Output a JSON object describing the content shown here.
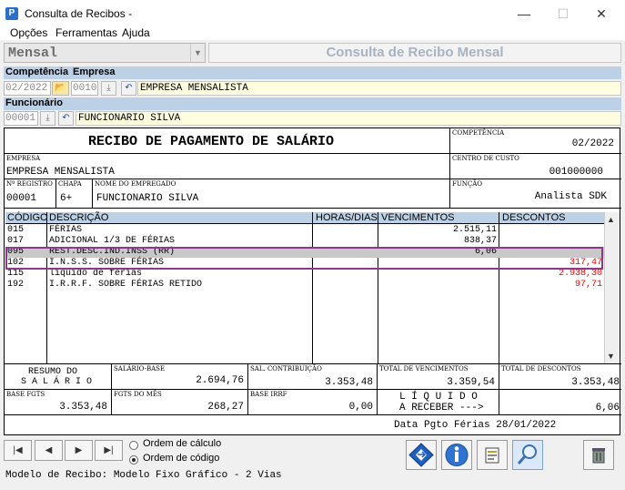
{
  "window": {
    "title": "Consulta de Recibos -",
    "app_icon": "P"
  },
  "menu": [
    "Opções",
    "Ferramentas",
    "Ajuda"
  ],
  "toolbar": {
    "mode": "Mensal",
    "banner": "Consulta de Recibo Mensal"
  },
  "filters": {
    "competencia_label": "Competência",
    "empresa_label": "Empresa",
    "competencia": "02/2022",
    "empresa_code": "0010",
    "empresa_name": "EMPRESA MENSALISTA",
    "funcionario_label": "Funcionário",
    "funcionario_code": "00001",
    "funcionario_name": "FUNCIONARIO SILVA"
  },
  "receipt": {
    "title": "RECIBO DE PAGAMENTO DE SALÁRIO",
    "competencia_cap": "COMPETÊNCIA",
    "competencia": "02/2022",
    "empresa_cap": "EMPRESA",
    "empresa": "EMPRESA MENSALISTA",
    "centro_cap": "CENTRO DE CUSTO",
    "centro": "001000000",
    "registro_cap": "Nº REGISTRO",
    "registro": "00001",
    "chapa_cap": "CHAPA",
    "chapa": "6+",
    "nome_cap": "NOME DO EMPREGADO",
    "nome": "FUNCIONARIO SILVA",
    "funcao_cap": "FUNÇÃO",
    "funcao": "Analista SDK"
  },
  "grid": {
    "headers": [
      "CÓDIGO",
      "DESCRIÇÃO",
      "HORAS/DIAS",
      "VENCIMENTOS",
      "DESCONTOS"
    ],
    "rows": [
      {
        "codigo": "015",
        "descricao": "FÉRIAS",
        "horas": "",
        "vencimentos": "2.515,11",
        "descontos": ""
      },
      {
        "codigo": "017",
        "descricao": "ADICIONAL 1/3 DE FÉRIAS",
        "horas": "",
        "vencimentos": "838,37",
        "descontos": ""
      },
      {
        "codigo": "095",
        "descricao": "REST.DESC.IND.INSS (RR)",
        "horas": "",
        "vencimentos": "6,06",
        "descontos": ""
      },
      {
        "codigo": "102",
        "descricao": "I.N.S.S. SOBRE FÉRIAS",
        "horas": "",
        "vencimentos": "",
        "descontos": "317,47"
      },
      {
        "codigo": "115",
        "descricao": "liquido de férias",
        "horas": "",
        "vencimentos": "",
        "descontos": "2.938,30"
      },
      {
        "codigo": "192",
        "descricao": "I.R.R.F. SOBRE FÉRIAS RETIDO",
        "horas": "",
        "vencimentos": "",
        "descontos": "97,71"
      }
    ],
    "discount_color": "#ff0000",
    "selected_row_color": "#c8c8c8",
    "highlight_border": "#8b3a8b"
  },
  "summary": {
    "resumo_line1": "RESUMO DO",
    "resumo_line2": "S A L Á R I O",
    "salario_base_cap": "SALÁRIO-BASE",
    "salario_base": "2.694,76",
    "sal_contrib_cap": "SAL. CONTRIBUIÇÃO",
    "sal_contrib": "3.353,48",
    "total_venc_cap": "TOTAL DE VENCIMENTOS",
    "total_venc": "3.359,54",
    "total_desc_cap": "TOTAL DE DESCONTOS",
    "total_desc": "3.353,48",
    "base_fgts_cap": "BASE FGTS",
    "base_fgts": "3.353,48",
    "fgts_mes_cap": "FGTS DO MÊS",
    "fgts_mes": "268,27",
    "base_irrf_cap": "BASE IRRF",
    "base_irrf": "0,00",
    "liquido_line1": "L Í Q U I D O",
    "liquido_line2": "A RECEBER --->",
    "liquido": "6,06",
    "data_pgto": "Data Pgto Férias 28/01/2022"
  },
  "bottom": {
    "nav": [
      "|◀",
      "◀",
      "▶",
      "▶|"
    ],
    "radio_calc": "Ordem de cálculo",
    "radio_code": "Ordem de código",
    "status": "Modelo de Recibo: Modelo Fixo Gráfico - 2 Vias"
  }
}
